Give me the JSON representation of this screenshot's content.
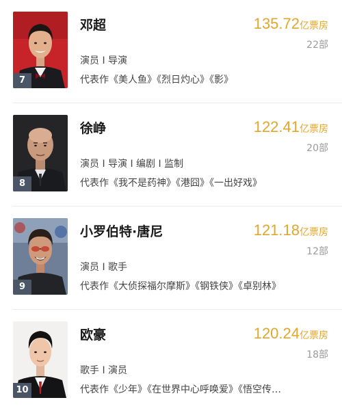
{
  "people": [
    {
      "name": "邓超",
      "gross_value": "135.72",
      "gross_unit": "亿票房",
      "films_count": "22部",
      "roles": "演员 I 导演",
      "works": "代表作《美人鱼》《烈日灼心》《影》",
      "rank": "7"
    },
    {
      "name": "徐峥",
      "gross_value": "122.41",
      "gross_unit": "亿票房",
      "films_count": "20部",
      "roles": "演员 I 导演 I 编剧 I 监制",
      "works": "代表作《我不是药神》《港囧》《一出好戏》",
      "rank": "8"
    },
    {
      "name": "小罗伯特·唐尼",
      "gross_value": "121.18",
      "gross_unit": "亿票房",
      "films_count": "12部",
      "roles": "演员 I 歌手",
      "works": "代表作《大侦探福尔摩斯》《钢铁侠》《卓别林》",
      "rank": "9"
    },
    {
      "name": "欧豪",
      "gross_value": "120.24",
      "gross_unit": "亿票房",
      "films_count": "18部",
      "roles": "歌手 I 演员",
      "works": "代表作《少年》《在世界中心呼唤爱》《悟空传…",
      "rank": "10"
    }
  ],
  "colors": {
    "gross_accent": "#e2a62b",
    "rank_badge": "#4a5666",
    "divider": "#ececec"
  }
}
